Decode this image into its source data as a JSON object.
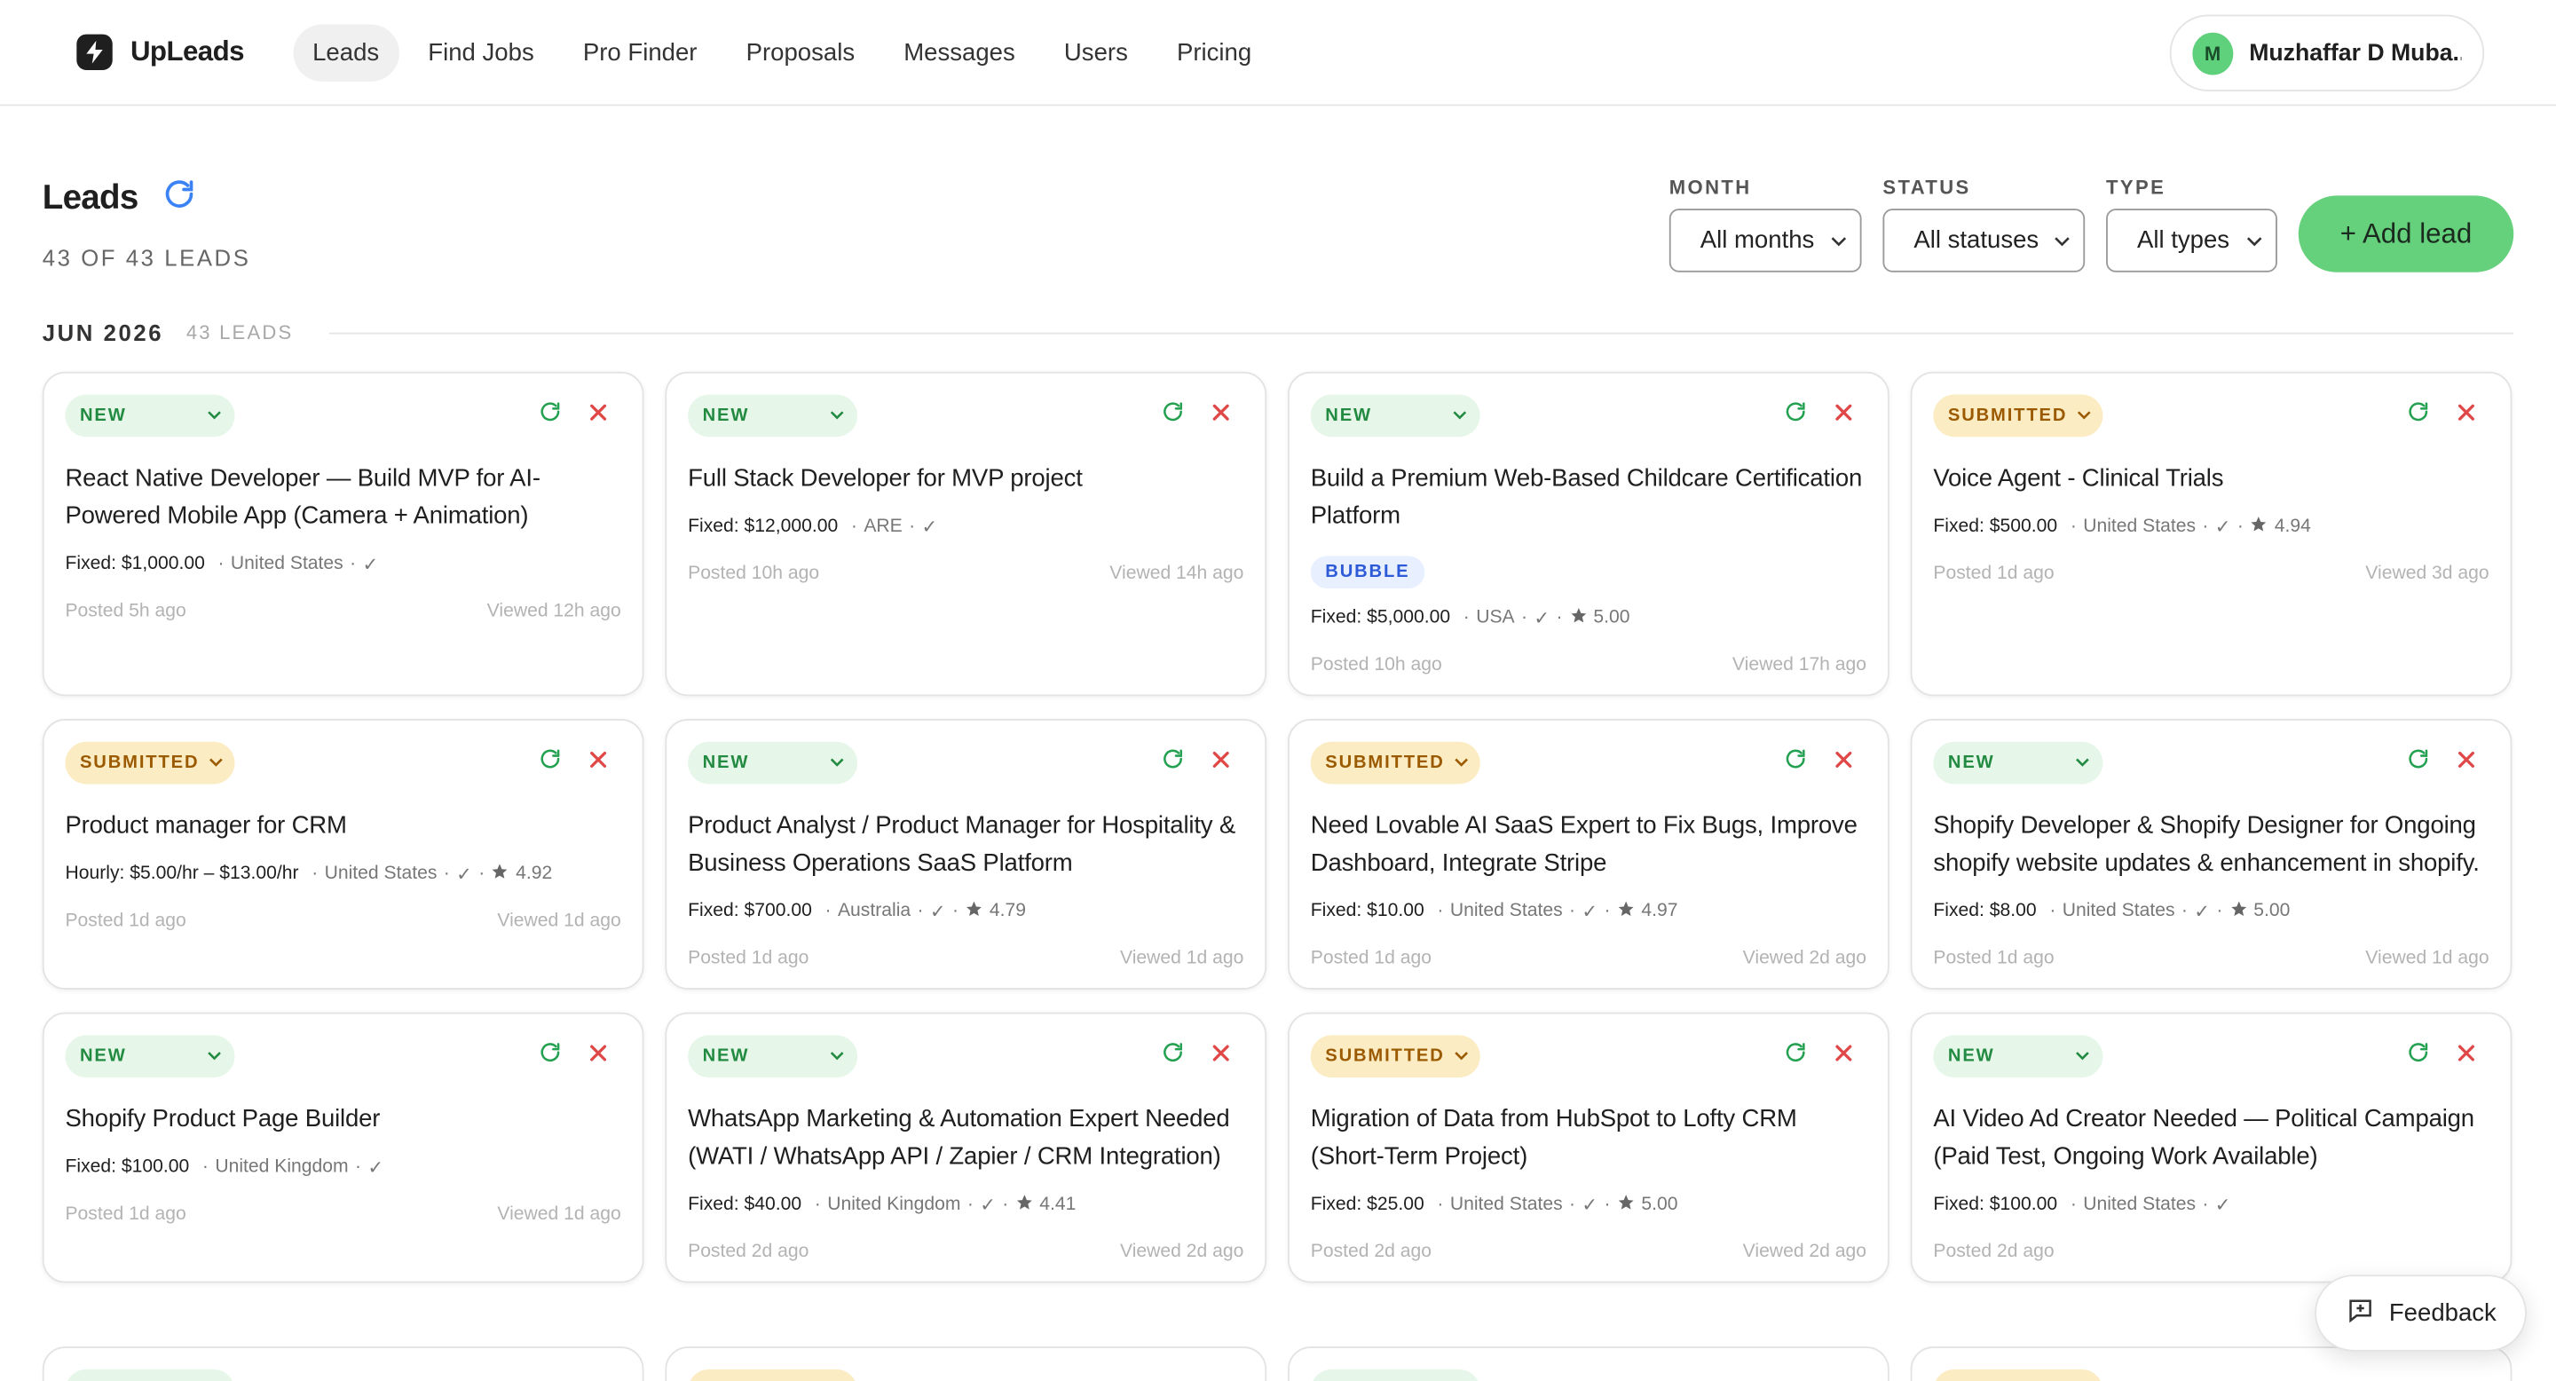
{
  "app": {
    "name": "UpLeads",
    "user_initial": "M",
    "user_name": "Muzhaffar D Muba..."
  },
  "nav": [
    "Leads",
    "Find Jobs",
    "Pro Finder",
    "Proposals",
    "Messages",
    "Users",
    "Pricing"
  ],
  "page": {
    "title": "Leads",
    "count": "43 OF 43 LEADS"
  },
  "filters": {
    "month": {
      "label": "MONTH",
      "value": "All months"
    },
    "status": {
      "label": "STATUS",
      "value": "All statuses"
    },
    "type": {
      "label": "TYPE",
      "value": "All types"
    }
  },
  "add_button": "+ Add lead",
  "group": {
    "title": "JUN 2026",
    "count": "43 LEADS"
  },
  "colors": {
    "accent_green": "#66d17c",
    "new_bg": "#e6f7e9",
    "submitted_bg": "#fbecc3",
    "tag_blue": "#2d5bd7",
    "close_red": "#e04848"
  },
  "cards": [
    {
      "status": "NEW",
      "title": "React Native Developer — Build MVP for AI-Powered Mobile App (Camera + Animation)",
      "price": "Fixed: $1,000.00",
      "location": "United States",
      "verified": "✓",
      "rating": "",
      "tag": "",
      "posted": "Posted 5h ago",
      "viewed": "Viewed 12h ago"
    },
    {
      "status": "NEW",
      "title": "Full Stack Developer for MVP project",
      "price": "Fixed: $12,000.00",
      "location": "ARE",
      "verified": "✓",
      "rating": "",
      "tag": "",
      "posted": "Posted 10h ago",
      "viewed": "Viewed 14h ago"
    },
    {
      "status": "NEW",
      "title": "Build a Premium Web-Based Childcare Certification Platform",
      "price": "Fixed: $5,000.00",
      "location": "USA",
      "verified": "✓",
      "rating": "5.00",
      "tag": "BUBBLE",
      "posted": "Posted 10h ago",
      "viewed": "Viewed 17h ago"
    },
    {
      "status": "SUBMITTED",
      "title": "Voice Agent - Clinical Trials",
      "price": "Fixed: $500.00",
      "location": "United States",
      "verified": "✓",
      "rating": "4.94",
      "tag": "",
      "posted": "Posted 1d ago",
      "viewed": "Viewed 3d ago"
    },
    {
      "status": "SUBMITTED",
      "title": "Product manager for CRM",
      "price": "Hourly: $5.00/hr – $13.00/hr",
      "location": "United States",
      "verified": "✓",
      "rating": "4.92",
      "tag": "",
      "posted": "Posted 1d ago",
      "viewed": "Viewed 1d ago"
    },
    {
      "status": "NEW",
      "title": "Product Analyst / Product Manager for Hospitality & Business Operations SaaS Platform",
      "price": "Fixed: $700.00",
      "location": "Australia",
      "verified": "✓",
      "rating": "4.79",
      "tag": "",
      "posted": "Posted 1d ago",
      "viewed": "Viewed 1d ago"
    },
    {
      "status": "SUBMITTED",
      "title": "Need Lovable AI SaaS Expert to Fix Bugs, Improve Dashboard, Integrate Stripe",
      "price": "Fixed: $10.00",
      "location": "United States",
      "verified": "✓",
      "rating": "4.97",
      "tag": "",
      "posted": "Posted 1d ago",
      "viewed": "Viewed 2d ago"
    },
    {
      "status": "NEW",
      "title": "Shopify Developer & Shopify Designer for Ongoing shopify website updates & enhancement in shopify.",
      "price": "Fixed: $8.00",
      "location": "United States",
      "verified": "✓",
      "rating": "5.00",
      "tag": "",
      "posted": "Posted 1d ago",
      "viewed": "Viewed 1d ago"
    },
    {
      "status": "NEW",
      "title": "Shopify Product Page Builder",
      "price": "Fixed: $100.00",
      "location": "United Kingdom",
      "verified": "✓",
      "rating": "",
      "tag": "",
      "posted": "Posted 1d ago",
      "viewed": "Viewed 1d ago"
    },
    {
      "status": "NEW",
      "title": "WhatsApp Marketing & Automation Expert Needed (WATI / WhatsApp API / Zapier / CRM Integration)",
      "price": "Fixed: $40.00",
      "location": "United Kingdom",
      "verified": "✓",
      "rating": "4.41",
      "tag": "",
      "posted": "Posted 2d ago",
      "viewed": "Viewed 2d ago"
    },
    {
      "status": "SUBMITTED",
      "title": "Migration of Data from HubSpot to Lofty CRM (Short-Term Project)",
      "price": "Fixed: $25.00",
      "location": "United States",
      "verified": "✓",
      "rating": "5.00",
      "tag": "",
      "posted": "Posted 2d ago",
      "viewed": "Viewed 2d ago"
    },
    {
      "status": "NEW",
      "title": "AI Video Ad Creator Needed — Political Campaign (Paid Test, Ongoing Work Available)",
      "price": "Fixed: $100.00",
      "location": "United States",
      "verified": "✓",
      "rating": "",
      "tag": "",
      "posted": "Posted 2d ago",
      "viewed": ""
    }
  ],
  "partial_row": [
    "new",
    "submitted",
    "new",
    "submitted"
  ],
  "feedback": "Feedback"
}
